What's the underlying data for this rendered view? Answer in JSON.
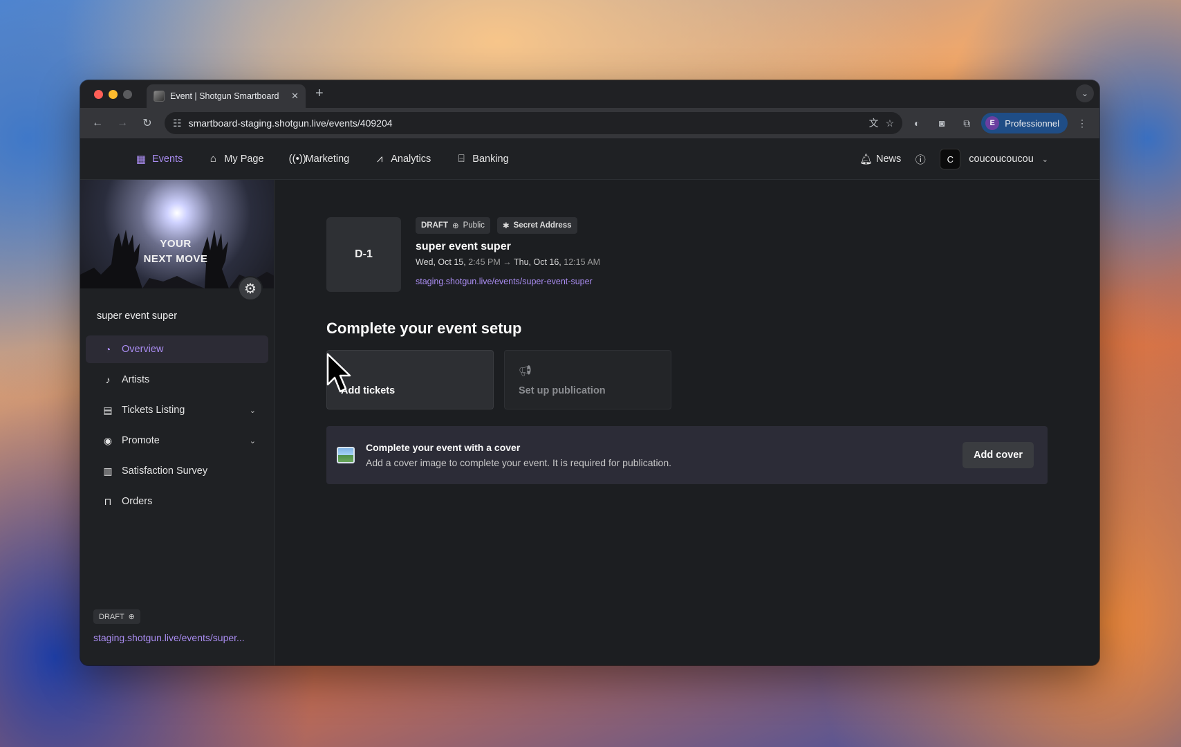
{
  "browser": {
    "tab_title": "Event | Shotgun Smartboard",
    "url": "smartboard-staging.shotgun.live/events/409204",
    "profile_label": "Professionnel",
    "profile_initial": "E"
  },
  "nav": {
    "items": [
      {
        "label": "Events",
        "icon": "calendar-icon"
      },
      {
        "label": "My Page",
        "icon": "home-icon"
      },
      {
        "label": "Marketing",
        "icon": "broadcast-icon"
      },
      {
        "label": "Analytics",
        "icon": "chart-line-icon"
      },
      {
        "label": "Banking",
        "icon": "bank-icon"
      }
    ],
    "news_label": "News",
    "user_initial": "C",
    "username": "coucoucoucou"
  },
  "sidebar": {
    "cover_text_line1": "YOUR",
    "cover_text_line2": "NEXT MOVE",
    "event_name": "super event super",
    "menu": [
      {
        "label": "Overview",
        "icon": "pie-chart-icon",
        "active": true
      },
      {
        "label": "Artists",
        "icon": "music-note-icon"
      },
      {
        "label": "Tickets Listing",
        "icon": "ticket-icon",
        "expandable": true
      },
      {
        "label": "Promote",
        "icon": "broadcast-icon",
        "expandable": true
      },
      {
        "label": "Satisfaction Survey",
        "icon": "survey-chart-icon"
      },
      {
        "label": "Orders",
        "icon": "bag-icon"
      }
    ],
    "status_badge": "DRAFT",
    "link": "staging.shotgun.live/events/super..."
  },
  "event": {
    "countdown": "D-1",
    "status": "DRAFT",
    "visibility": "Public",
    "address_tag": "Secret Address",
    "title": "super event super",
    "start_day": "Wed, Oct 15,",
    "start_time": "2:45 PM",
    "end_day": "Thu, Oct 16,",
    "end_time": "12:15 AM",
    "link": "staging.shotgun.live/events/super-event-super"
  },
  "setup": {
    "title": "Complete your event setup",
    "cards": [
      {
        "label": "Add tickets",
        "icon": "ticket-icon"
      },
      {
        "label": "Set up publication",
        "icon": "megaphone-icon"
      }
    ],
    "cover_banner": {
      "title": "Complete your event with a cover",
      "description": "Add a cover image to complete your event. It is required for publication.",
      "button": "Add cover"
    }
  },
  "colors": {
    "accent": "#a98cf0",
    "background": "#1c1e21",
    "sidebar": "#1f2124"
  }
}
